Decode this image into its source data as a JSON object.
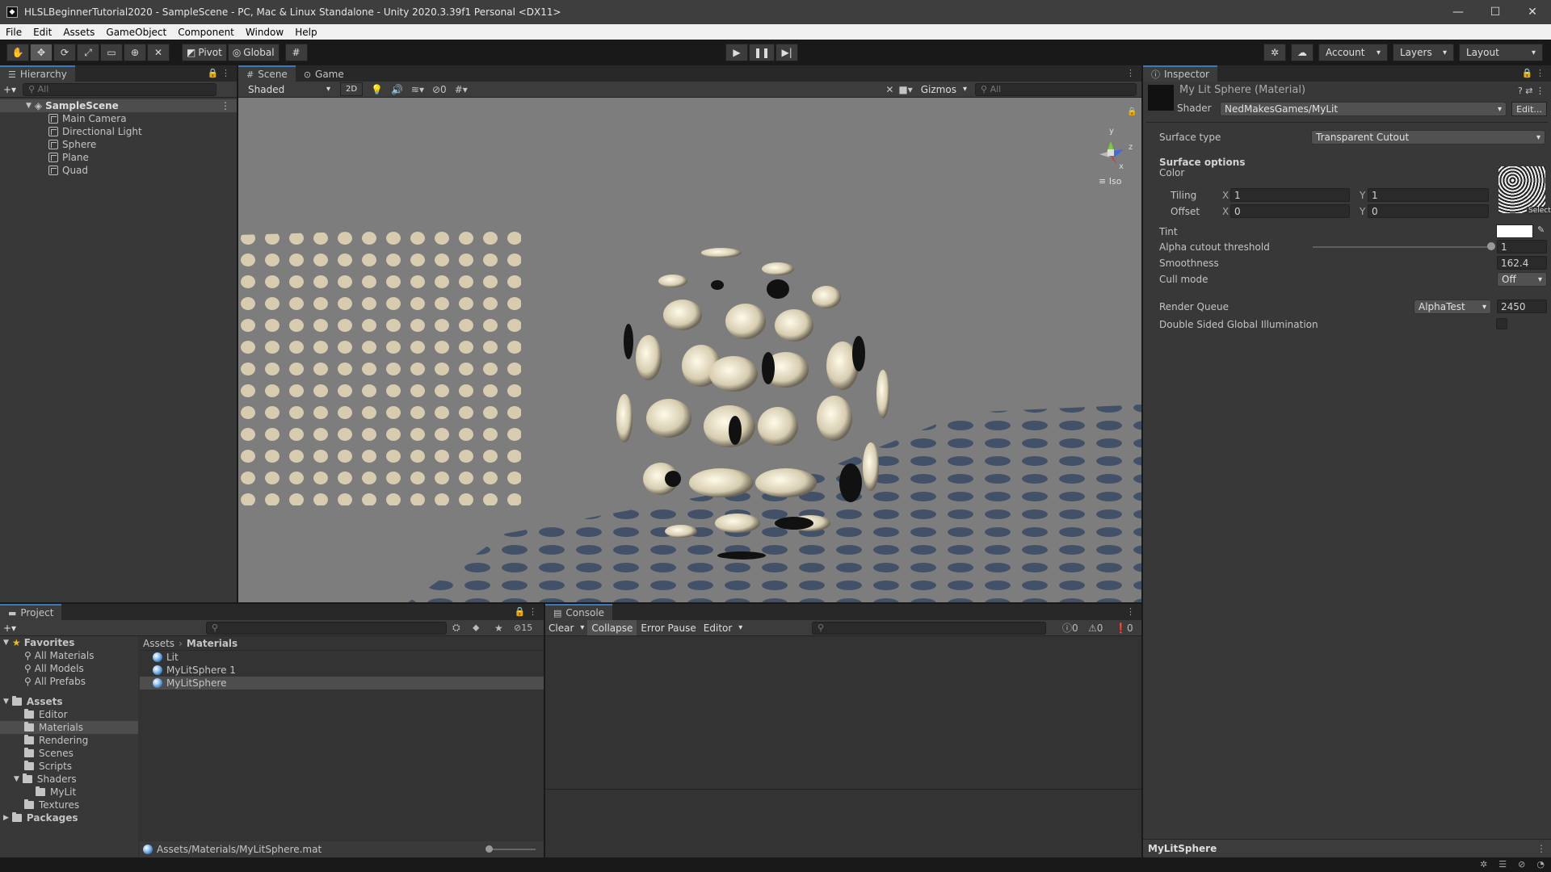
{
  "window": {
    "title": "HLSLBeginnerTutorial2020 - SampleScene - PC, Mac & Linux Standalone - Unity 2020.3.39f1 Personal <DX11>"
  },
  "menu": [
    "File",
    "Edit",
    "Assets",
    "GameObject",
    "Component",
    "Window",
    "Help"
  ],
  "toolbar": {
    "pivot": "Pivot",
    "global": "Global",
    "account": "Account",
    "layers": "Layers",
    "layout": "Layout"
  },
  "hierarchy": {
    "tab": "Hierarchy",
    "search_placeholder": "All",
    "scene": "SampleScene",
    "items": [
      "Main Camera",
      "Directional Light",
      "Sphere",
      "Plane",
      "Quad"
    ]
  },
  "scene": {
    "tabs": [
      "Scene",
      "Game"
    ],
    "shading": "Shaded",
    "mode_2d": "2D",
    "hidden_count": "0",
    "gizmos": "Gizmos",
    "search_placeholder": "All",
    "projection": "Iso",
    "gizmo_axes": {
      "y": "y",
      "z": "z",
      "x": "x"
    }
  },
  "inspector": {
    "tab": "Inspector",
    "title": "My Lit Sphere (Material)",
    "shader_label": "Shader",
    "shader_value": "NedMakesGames/MyLit",
    "edit_button": "Edit...",
    "surface_type_label": "Surface type",
    "surface_type_value": "Transparent Cutout",
    "surface_options": "Surface options",
    "color_label": "Color",
    "tiling_label": "Tiling",
    "tiling_x": "1",
    "tiling_y": "1",
    "offset_label": "Offset",
    "offset_x": "0",
    "offset_y": "0",
    "axis_x": "X",
    "axis_y": "Y",
    "select": "Select",
    "tint_label": "Tint",
    "alpha_label": "Alpha cutout threshold",
    "alpha_value": "1",
    "alpha_fraction": 1.0,
    "smoothness_label": "Smoothness",
    "smoothness_value": "162.4",
    "cull_label": "Cull mode",
    "cull_value": "Off",
    "render_queue_label": "Render Queue",
    "render_queue_mode": "AlphaTest",
    "render_queue_value": "2450",
    "dsgi_label": "Double Sided Global Illumination",
    "footer": "MyLitSphere"
  },
  "project": {
    "tab": "Project",
    "hidden_count": "15",
    "favorites_label": "Favorites",
    "favorites": [
      "All Materials",
      "All Models",
      "All Prefabs"
    ],
    "assets_label": "Assets",
    "asset_folders": [
      "Editor",
      "Materials",
      "Rendering",
      "Scenes",
      "Scripts",
      "Shaders"
    ],
    "shader_sub": [
      "MyLit"
    ],
    "textures": "Textures",
    "packages": "Packages",
    "breadcrumb": [
      "Assets",
      "Materials"
    ],
    "files": [
      "Lit",
      "MyLitSphere 1",
      "MyLitSphere"
    ],
    "footer_path": "Assets/Materials/MyLitSphere.mat"
  },
  "console": {
    "tab": "Console",
    "clear": "Clear",
    "collapse": "Collapse",
    "error_pause": "Error Pause",
    "editor": "Editor",
    "log_count": "0",
    "warn_count": "0",
    "error_count": "0"
  }
}
